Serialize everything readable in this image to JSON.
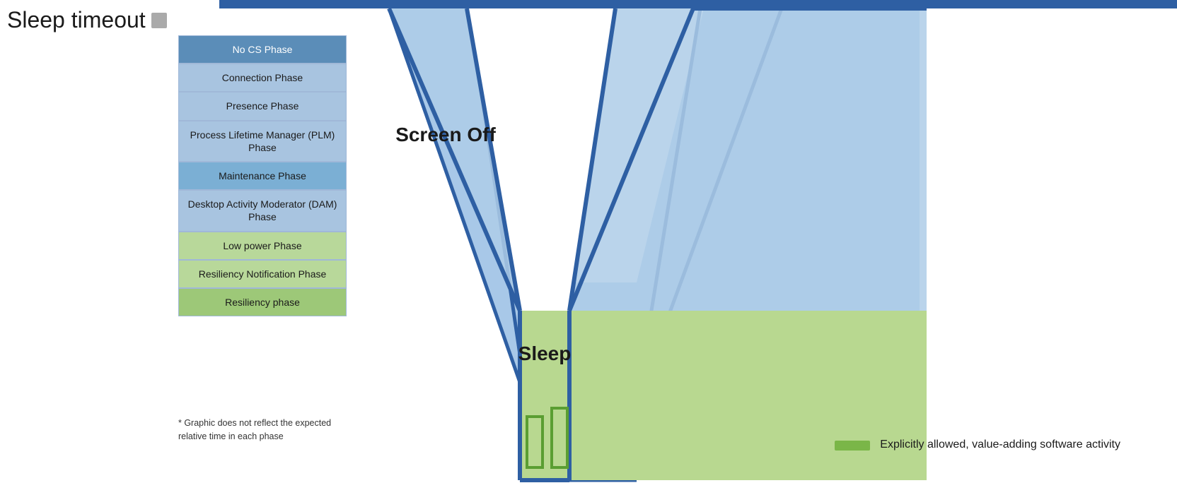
{
  "title": "Sleep timeout",
  "title_icon": "info-icon",
  "phases": [
    {
      "label": "No CS Phase",
      "style": "blue-dark"
    },
    {
      "label": "Connection Phase",
      "style": "blue-light"
    },
    {
      "label": "Presence Phase",
      "style": "blue-light"
    },
    {
      "label": "Process Lifetime Manager (PLM) Phase",
      "style": "blue-light"
    },
    {
      "label": "Maintenance Phase",
      "style": "blue-mid"
    },
    {
      "label": "Desktop Activity Moderator (DAM) Phase",
      "style": "blue-light"
    },
    {
      "label": "Low power Phase",
      "style": "green-light"
    },
    {
      "label": "Resiliency Notification Phase",
      "style": "green-light"
    },
    {
      "label": "Resiliency phase",
      "style": "green-mid"
    }
  ],
  "disclaimer": "* Graphic does not reflect the expected relative time in each phase",
  "diagram": {
    "screen_off_label": "Screen Off",
    "sleep_label": "Sleep"
  },
  "legend": {
    "color": "#7AB648",
    "text": "Explicitly allowed, value-adding software activity"
  },
  "colors": {
    "blue_border": "#2E5FA3",
    "blue_fill": "#A8C8E8",
    "green_fill": "#B8D88A",
    "green_activity": "#7AB648"
  }
}
